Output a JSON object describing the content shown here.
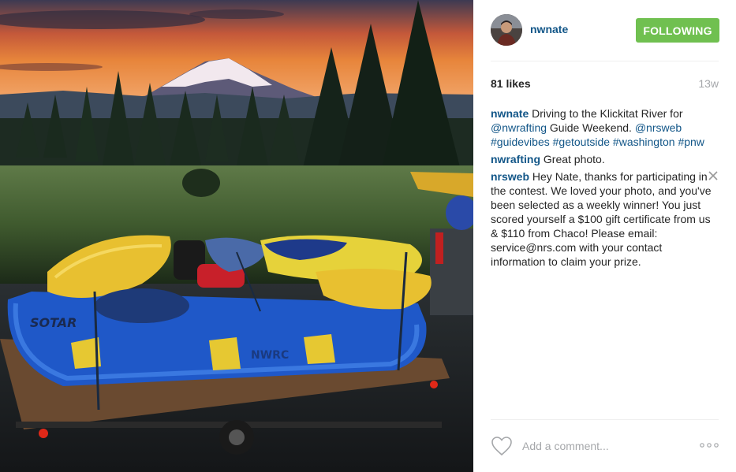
{
  "post": {
    "username": "nwnate",
    "follow_label": "FOLLOWING",
    "likes": "81 likes",
    "time_ago": "13w"
  },
  "caption": {
    "user": "nwnate",
    "text_1": " Driving to the Klickitat River for ",
    "tag_1": "@nwrafting",
    "text_2": " Guide Weekend. ",
    "tag_2": "@nrsweb",
    "text_3": " ",
    "tag_3": "#guidevibes",
    "text_4": " ",
    "tag_4": "#getoutside",
    "text_5": " ",
    "tag_5": "#washington",
    "text_6": " ",
    "tag_6": "#pnw"
  },
  "comments": [
    {
      "user": "nwrafting",
      "text": " Great photo."
    },
    {
      "user": "nrsweb",
      "text": " Hey Nate, thanks for participating in the contest. We loved your photo, and you've been selected as a weekly winner! You just scored yourself a $100 gift certificate from us & $110 from Chaco! Please email: service@nrs.com with your contact information to claim your prize."
    }
  ],
  "footer": {
    "comment_placeholder": "Add a comment..."
  },
  "icons": {
    "heart": "heart-icon",
    "more": "more-options-icon",
    "close": "close-icon"
  },
  "colors": {
    "username_link": "#125688",
    "follow_button": "#70c050",
    "muted_text": "#a5a7aa"
  },
  "photo": {
    "raft_text_1": "SOTAR",
    "raft_text_2": "NWRC"
  }
}
